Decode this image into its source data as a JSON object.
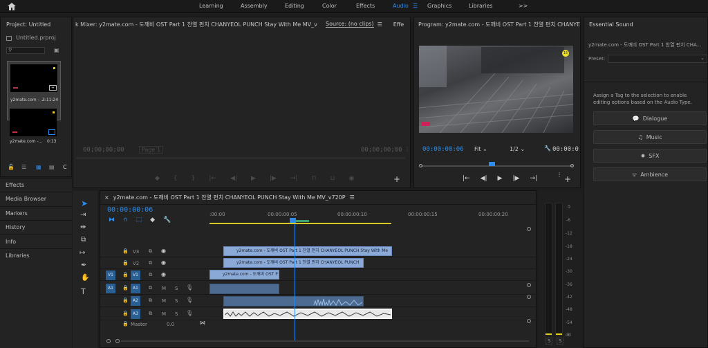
{
  "workspaces": [
    "Learning",
    "Assembly",
    "Editing",
    "Color",
    "Effects",
    "Audio",
    "Graphics",
    "Libraries"
  ],
  "active_workspace": "Audio",
  "more_symbol": ">>",
  "project": {
    "title": "Project: Untitled",
    "filename": "Untitled.prproj",
    "items": [
      {
        "name": "y2mate.com - ...",
        "duration": "3:11:24"
      },
      {
        "name": "y2mate.com -...",
        "duration": "0:13"
      }
    ],
    "c_label": "C"
  },
  "left_panels": [
    "Effects",
    "Media Browser",
    "Markers",
    "History",
    "Info",
    "Libraries"
  ],
  "source_monitor": {
    "tab_mixer": "k Mixer: y2mate.com - 도깨비 OST Part 1 찬열 펀치 CHANYEOL PUNCH  Stay With Me MV_v720P",
    "tab_source": "Source: (no clips)",
    "tab_effe": "Effe",
    "timecode_left": "00;00;00;00",
    "page": "Page 1",
    "timecode_right": "00;00;00;00"
  },
  "program_monitor": {
    "title": "Program: y2mate.com - 도깨비 OST Part 1 찬열 펀치 CHANYEOL PUNCH",
    "timecode": "00:00:00:06",
    "fit": "Fit",
    "res": "1/2",
    "timecode_right": "00:00:0",
    "badge": "15"
  },
  "timeline": {
    "title": "y2mate.com - 도깨비 OST Part 1 찬열 펀치 CHANYEOL PUNCH  Stay With Me MV_v720P",
    "timecode": "00:00:00:06",
    "ruler": [
      ":00:00",
      "00:00:00:05",
      "00:00:00:10",
      "00:00:00:15",
      "00:00:00:20"
    ],
    "video_tracks": [
      "V3",
      "V2",
      "V1"
    ],
    "audio_tracks": [
      "A1",
      "A2",
      "A3"
    ],
    "source_v": "V1",
    "source_a": "A1",
    "mute": "M",
    "solo": "S",
    "master_label": "Master",
    "master_value": "0.0",
    "clip_v3": "y2mate.com - 도깨비 OST Part 1 찬열 펀치 CHANYEOL PUNCH  Stay With Me",
    "clip_v2": "y2mate.com - 도깨비 OST Part 1 찬열 펀치 CHANYEOL PUNCH",
    "clip_v1": "y2mate.com - 도깨비 OST P"
  },
  "vu_meter": {
    "ticks": [
      "0",
      "-6",
      "-12",
      "-18",
      "-24",
      "-30",
      "-36",
      "-42",
      "-48",
      "-54",
      "dB"
    ],
    "solo_left": "S",
    "solo_right": "S"
  },
  "essential_sound": {
    "title": "Essential Sound",
    "clip_name": "y2mate.com - 도깨비 OST Part 1 찬열 펀치 CHA...",
    "preset_label": "Preset:",
    "hint": "Assign a Tag to the selection to enable editing options based on the Audio Type.",
    "buttons": [
      "Dialogue",
      "Music",
      "SFX",
      "Ambience"
    ]
  },
  "colors": {
    "accent": "#2d8ceb",
    "clip_video": "#8aa9d6",
    "clip_audio": "#4d6a90",
    "work_area": "#d8c92a"
  }
}
